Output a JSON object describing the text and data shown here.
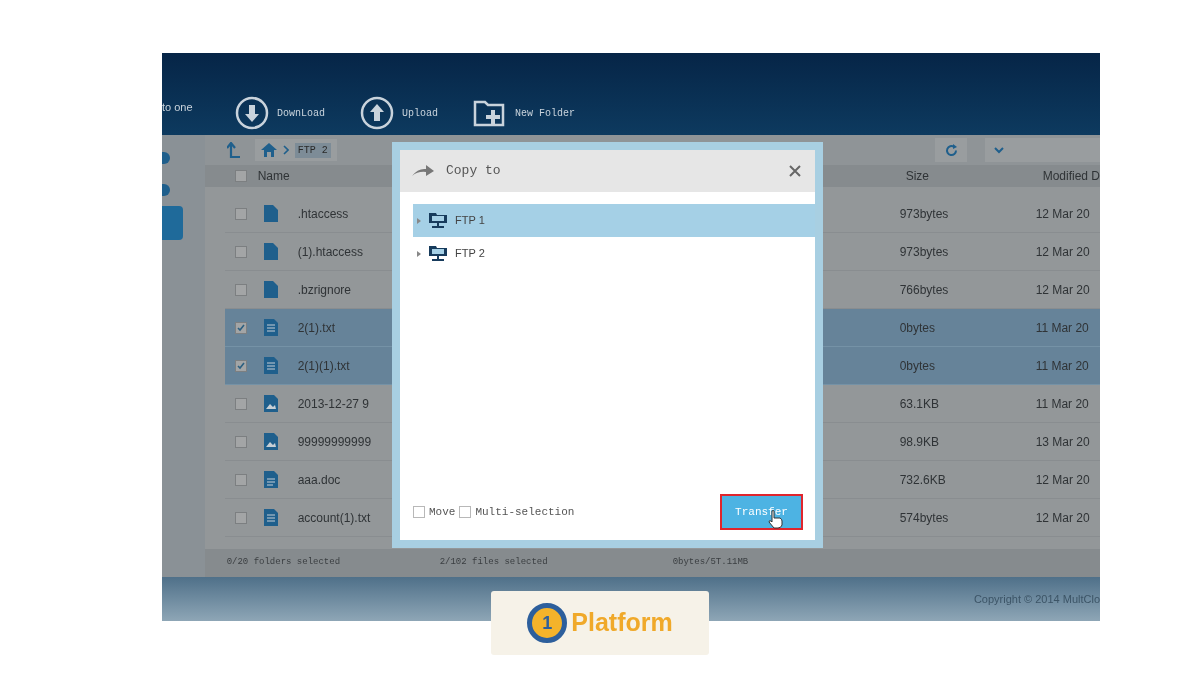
{
  "sidebar": {
    "label": "to one"
  },
  "toolbar": [
    {
      "kind": "download",
      "label": "DownLoad"
    },
    {
      "kind": "upload",
      "label": "Upload"
    },
    {
      "kind": "folder",
      "label": "New Folder"
    }
  ],
  "breadcrumb": {
    "current": "FTP 2"
  },
  "table": {
    "all_checked": false,
    "columns": [
      "Name",
      "Size",
      "Modified D"
    ],
    "rows": [
      {
        "kind": "file",
        "name": ".htaccess",
        "size": "973bytes",
        "modified": "12 Mar 20",
        "checked": false
      },
      {
        "kind": "file",
        "name": "(1).htaccess",
        "size": "973bytes",
        "modified": "12 Mar 20",
        "checked": false
      },
      {
        "kind": "file",
        "name": ".bzrignore",
        "size": "766bytes",
        "modified": "12 Mar 20",
        "checked": false
      },
      {
        "kind": "text",
        "name": "2(1).txt",
        "size": "0bytes",
        "modified": "11 Mar 20",
        "checked": true
      },
      {
        "kind": "text",
        "name": "2(1)(1).txt",
        "size": "0bytes",
        "modified": "11 Mar 20",
        "checked": true
      },
      {
        "kind": "image",
        "name": "2013-12-27 9",
        "size": "63.1KB",
        "modified": "11 Mar 20",
        "checked": false
      },
      {
        "kind": "image",
        "name": "99999999999",
        "size": "98.9KB",
        "modified": "13 Mar 20",
        "checked": false
      },
      {
        "kind": "doc",
        "name": "aaa.doc",
        "size": "732.6KB",
        "modified": "12 Mar 20",
        "checked": false
      },
      {
        "kind": "text",
        "name": "account(1).txt",
        "size": "574bytes",
        "modified": "12 Mar 20",
        "checked": false
      }
    ]
  },
  "status_bar": [
    "0/20 folders selected",
    "2/102 files selected",
    "0bytes/5T.11MB"
  ],
  "footer": {
    "copyright": "Copyright © 2014 MultClo"
  },
  "logo": {
    "mark": "1",
    "text": "Platform"
  },
  "dialog": {
    "title": "Copy to",
    "tree": [
      {
        "label": "FTP 1",
        "selected": true,
        "expanded": false
      },
      {
        "label": "FTP 2",
        "selected": false,
        "expanded": false
      }
    ],
    "options": [
      {
        "label": "Move",
        "checked": false
      },
      {
        "label": "Multi-selection",
        "checked": false
      }
    ],
    "button": "Transfer"
  }
}
